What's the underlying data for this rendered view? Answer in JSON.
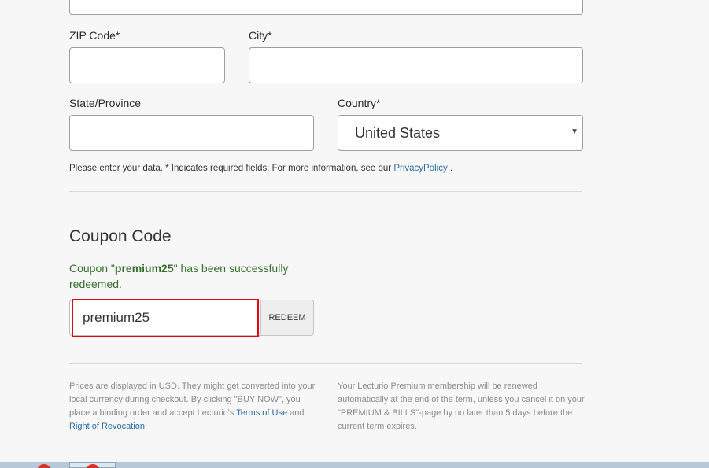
{
  "form": {
    "zip_label": "ZIP Code*",
    "zip_value": "",
    "city_label": "City*",
    "city_value": "",
    "state_label": "State/Province",
    "state_value": "",
    "country_label": "Country*",
    "country_selected": "United States",
    "note_prefix": "Please enter your data. * Indicates required fields. For more information, see our",
    "note_link": "PrivacyPolicy",
    "note_suffix": "."
  },
  "coupon": {
    "title": "Coupon Code",
    "success_prefix": "Coupon \"",
    "success_code": "premium25",
    "success_suffix": "\" has been successfully redeemed.",
    "input_value": "premium25",
    "redeem_label": "REDEEM"
  },
  "footer": {
    "left_text": "Prices are displayed in USD. They might get converted into your local currency during checkout. By clicking \"BUY NOW\", you place a binding order and accept Lecturio's",
    "terms_link": "Terms of Use",
    "and_text": "and",
    "revocation_link": "Right of Revocation",
    "period": ".",
    "right_text": "Your Lecturio Premium membership will be renewed automatically at the end of the term, unless you cancel it on your \"PREMIUM & BILLS\"-page by no later than 5 days before the current term expires."
  },
  "colors": {
    "link": "#2a6ea6",
    "success": "#3a6e2f",
    "highlight": "#e30613"
  }
}
